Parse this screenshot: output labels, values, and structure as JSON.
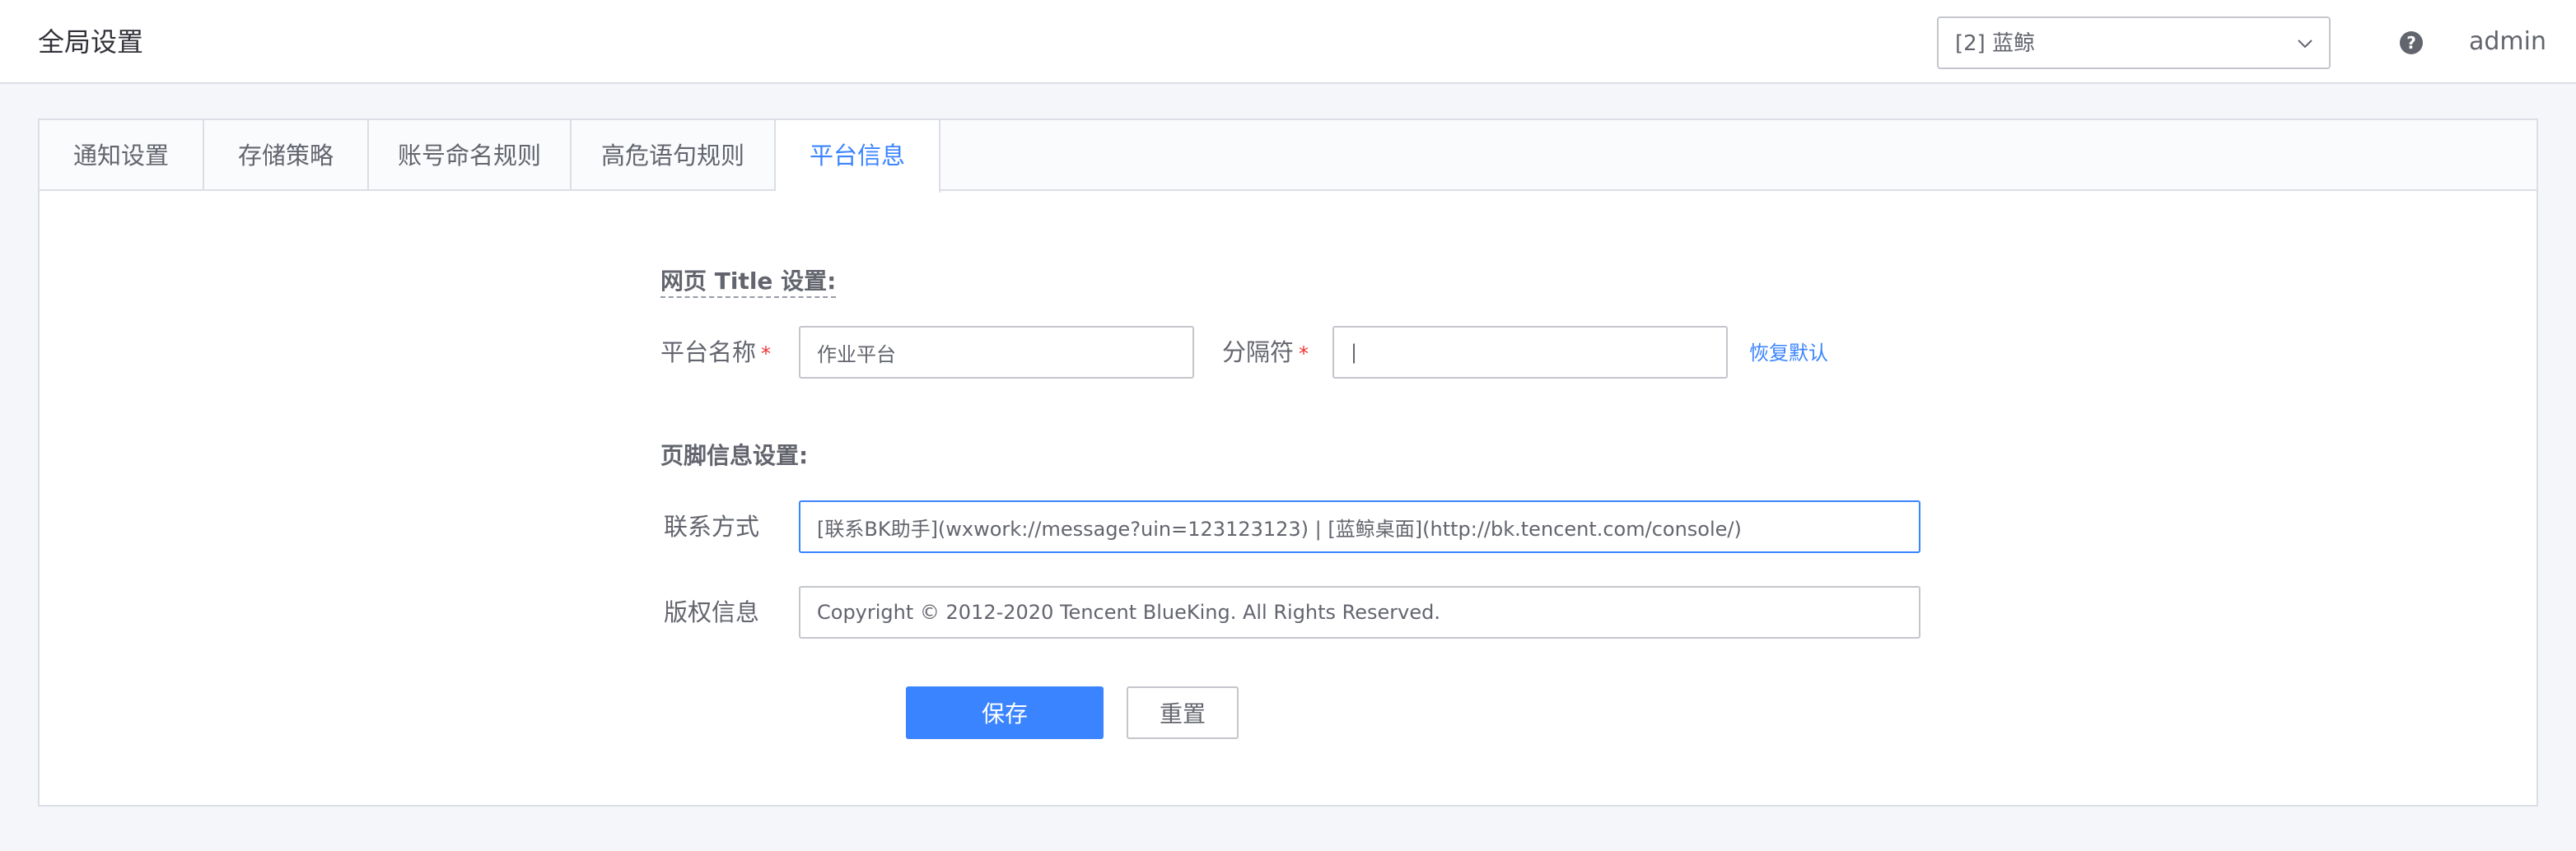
{
  "header": {
    "title": "全局设置",
    "business_select": "[2] 蓝鲸",
    "help": "?",
    "user": "admin"
  },
  "tabs": [
    {
      "label": "通知设置",
      "active": false
    },
    {
      "label": "存储策略",
      "active": false
    },
    {
      "label": "账号命名规则",
      "active": false
    },
    {
      "label": "高危语句规则",
      "active": false
    },
    {
      "label": "平台信息",
      "active": true
    }
  ],
  "title_settings": {
    "heading": "网页 Title 设置:",
    "platform_name_label": "平台名称",
    "platform_name_value": "作业平台",
    "separator_label": "分隔符",
    "separator_value": "|",
    "restore_default": "恢复默认",
    "required_mark": "*"
  },
  "footer_settings": {
    "heading": "页脚信息设置:",
    "contact_label": "联系方式",
    "contact_value": "[联系BK助手](wxwork://message?uin=123123123) | [蓝鲸桌面](http://bk.tencent.com/console/)",
    "copyright_label": "版权信息",
    "copyright_value": "Copyright © 2012-2020 Tencent BlueKing. All Rights Reserved."
  },
  "actions": {
    "save": "保存",
    "reset": "重置"
  },
  "colors": {
    "accent": "#3a84ff",
    "required": "#ea3636"
  }
}
